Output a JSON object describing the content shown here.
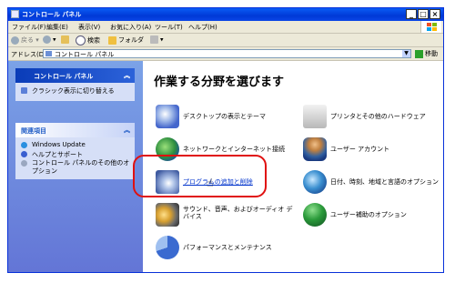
{
  "window": {
    "title": "コントロール パネル"
  },
  "menubar": {
    "items": [
      "ファイル(F)",
      "編集(E)",
      "表示(V)",
      "お気に入り(A)",
      "ツール(T)",
      "ヘルプ(H)"
    ]
  },
  "toolbar": {
    "back": "戻る",
    "search": "検索",
    "folders": "フォルダ"
  },
  "addressbar": {
    "label": "アドレス(D)",
    "value": "コントロール パネル",
    "go": "移動"
  },
  "sidebar": {
    "cp_panel": {
      "title": "コントロール パネル",
      "items": [
        "クラシック表示に切り替える"
      ]
    },
    "related": {
      "title": "関連項目",
      "items": [
        "Windows Update",
        "ヘルプとサポート",
        "コントロール パネルのその他のオプション"
      ]
    }
  },
  "main": {
    "heading": "作業する分野を選びます",
    "categories": [
      "デスクトップの表示とテーマ",
      "プリンタとその他のハードウェア",
      "ネットワークとインターネット接続",
      "ユーザー アカウント",
      "プログラムの追加と削除",
      "日付、時刻、地域と言語のオプション",
      "サウンド、音声、およびオーディオ デバイス",
      "ユーザー補助のオプション",
      "パフォーマンスとメンテナンス"
    ]
  },
  "colors": {
    "titlebar": "#0a5cf5",
    "sidebar": "#6b8fe0",
    "highlight": "#e01010",
    "link": "#0033cc"
  },
  "icons": [
    "control-panel-icon",
    "back-icon",
    "forward-icon",
    "up-icon",
    "search-icon",
    "folder-icon",
    "view-icon",
    "go-icon",
    "windows-logo-icon",
    "cursor-icon"
  ]
}
